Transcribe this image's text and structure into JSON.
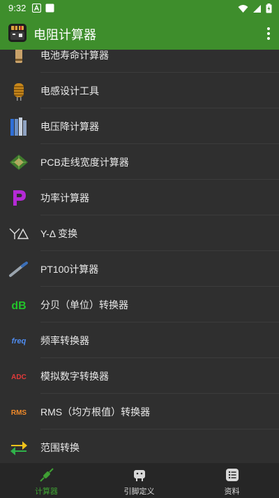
{
  "status_bar": {
    "time": "9:32"
  },
  "app_bar": {
    "title": "电阻计算器"
  },
  "list": {
    "items": [
      {
        "label": "电池寿命计算器",
        "icon": "battery-icon"
      },
      {
        "label": "电感设计工具",
        "icon": "inductor-icon"
      },
      {
        "label": "电压降计算器",
        "icon": "voltage-drop-icon"
      },
      {
        "label": "PCB走线宽度计算器",
        "icon": "pcb-icon"
      },
      {
        "label": "功率计算器",
        "icon": "power-p-icon"
      },
      {
        "label": "Y-Δ 变换",
        "icon": "y-delta-icon"
      },
      {
        "label": "PT100计算器",
        "icon": "pt100-probe-icon"
      },
      {
        "label": "分贝（单位）转换器",
        "icon": "db-icon"
      },
      {
        "label": "频率转换器",
        "icon": "freq-icon"
      },
      {
        "label": "模拟数字转换器",
        "icon": "adc-icon"
      },
      {
        "label": "RMS（均方根值）转换器",
        "icon": "rms-icon"
      },
      {
        "label": "范围转换",
        "icon": "range-arrows-icon"
      }
    ]
  },
  "icon_text": {
    "db": "dB",
    "freq": "freq",
    "adc": "ADC",
    "rms": "RMS"
  },
  "bottom_nav": {
    "items": [
      {
        "label": "计算器",
        "active": true
      },
      {
        "label": "引脚定义",
        "active": false
      },
      {
        "label": "资料",
        "active": false
      }
    ]
  },
  "colors": {
    "brand_green": "#3e8e2c",
    "active_nav": "#3fa033",
    "background": "#2f2f2f"
  }
}
